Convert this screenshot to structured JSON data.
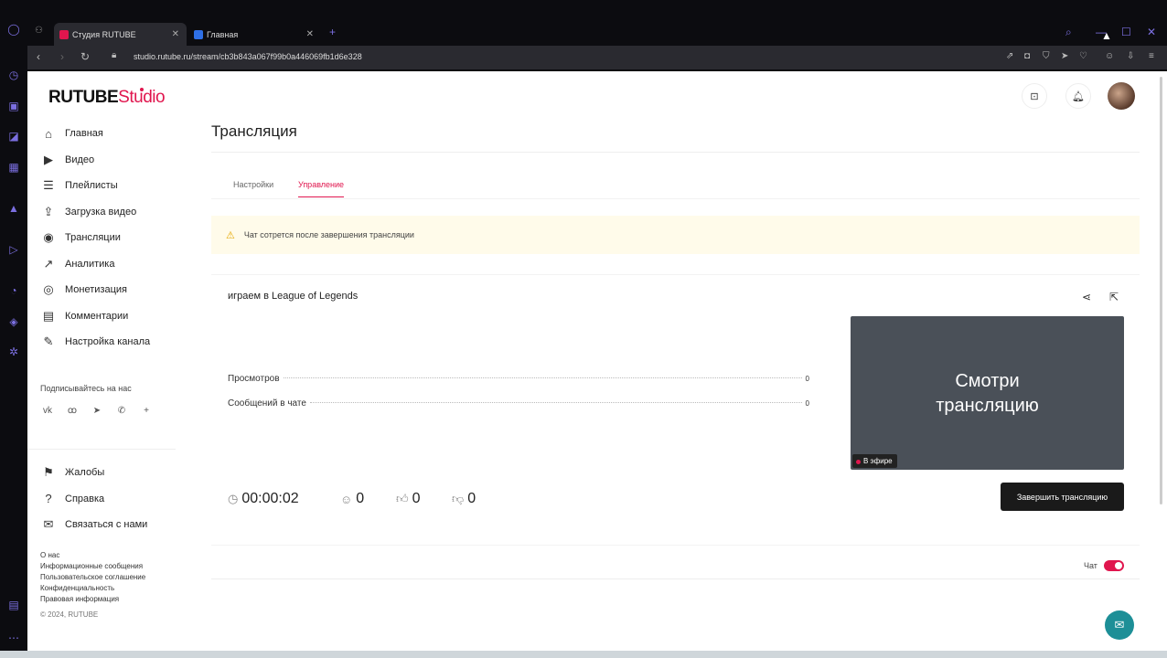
{
  "browser": {
    "tabs": [
      {
        "label": "Студия RUTUBE",
        "fav_color": "#e0164e"
      },
      {
        "label": "Главная",
        "fav_color": "#2e6fe6"
      }
    ],
    "new_tab": "+",
    "url": "studio.rutube.ru/stream/cb3b843a067f99b0a446069fb1d6e328"
  },
  "app": {
    "logo_main": "RUTUBE",
    "logo_studio": "Studio",
    "brand_color": "#e0164e"
  },
  "sidebar": {
    "items": [
      {
        "label": "Главная",
        "icon": "home-icon",
        "glyph": "⌂"
      },
      {
        "label": "Видео",
        "icon": "video-icon",
        "glyph": "▶"
      },
      {
        "label": "Плейлисты",
        "icon": "playlist-icon",
        "glyph": "☰"
      },
      {
        "label": "Загрузка видео",
        "icon": "upload-icon",
        "glyph": "⇪"
      },
      {
        "label": "Трансляции",
        "icon": "broadcast-icon",
        "glyph": "◉"
      },
      {
        "label": "Аналитика",
        "icon": "analytics-icon",
        "glyph": "↗"
      },
      {
        "label": "Монетизация",
        "icon": "money-icon",
        "glyph": "◎"
      },
      {
        "label": "Комментарии",
        "icon": "comments-icon",
        "glyph": "▤"
      },
      {
        "label": "Настройка канала",
        "icon": "channel-settings-icon",
        "glyph": "✎"
      }
    ],
    "subscribe_title": "Подписывайтесь на нас",
    "socials": [
      "vk-icon",
      "ok-icon",
      "telegram-icon",
      "viber-icon",
      "plus-icon"
    ],
    "secondary": [
      {
        "label": "Жалобы",
        "icon": "flag-icon",
        "glyph": "⚑"
      },
      {
        "label": "Справка",
        "icon": "help-icon",
        "glyph": "?"
      },
      {
        "label": "Связаться с нами",
        "icon": "contact-icon",
        "glyph": "✉"
      }
    ],
    "footer_links": [
      "О нас",
      "Информационные сообщения",
      "Пользовательское соглашение",
      "Конфиденциальность",
      "Правовая информация"
    ],
    "copyright": "© 2024, RUTUBE"
  },
  "main": {
    "title": "Трансляция",
    "tabs": [
      {
        "label": "Настройки",
        "active": false
      },
      {
        "label": "Управление",
        "active": true
      }
    ],
    "warning": "Чат сотрется после завершения трансляции",
    "stream": {
      "title": "играем в League of Legends",
      "stats": [
        {
          "label": "Просмотров",
          "value": "0"
        },
        {
          "label": "Сообщений в чате",
          "value": "0"
        }
      ],
      "preview_text_line1": "Смотри",
      "preview_text_line2": "трансляцию",
      "live_badge": "В эфире",
      "duration": "00:00:02",
      "viewers": "0",
      "likes": "0",
      "dislikes": "0",
      "end_button": "Завершить трансляцию"
    },
    "chat": {
      "label": "Чат",
      "enabled": true
    }
  }
}
